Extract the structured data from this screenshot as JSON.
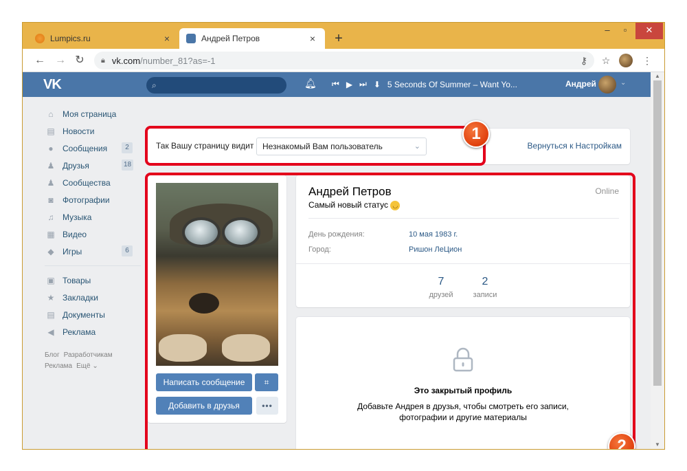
{
  "browser": {
    "tabs": [
      {
        "title": "Lumpics.ru",
        "close": "×"
      },
      {
        "title": "Андрей Петров",
        "close": "×"
      }
    ],
    "new_tab": "+",
    "controls": {
      "minimize": "–",
      "maximize": "▫",
      "close": "✕"
    },
    "url": {
      "host": "vk.com",
      "path": "/number_81?as=-1"
    },
    "menu": "⋮"
  },
  "vk": {
    "logo": "VK",
    "player": {
      "track": "5 Seconds Of Summer – Want Yo..."
    },
    "user_name": "Андрей"
  },
  "sidebar": {
    "items": [
      {
        "label": "Моя страница",
        "icon": "⌂"
      },
      {
        "label": "Новости",
        "icon": "▤"
      },
      {
        "label": "Сообщения",
        "icon": "●",
        "count": "2"
      },
      {
        "label": "Друзья",
        "icon": "♟",
        "count": "18"
      },
      {
        "label": "Сообщества",
        "icon": "♟"
      },
      {
        "label": "Фотографии",
        "icon": "◙"
      },
      {
        "label": "Музыка",
        "icon": "♫"
      },
      {
        "label": "Видео",
        "icon": "▦"
      },
      {
        "label": "Игры",
        "icon": "◆",
        "count": "6"
      }
    ],
    "items2": [
      {
        "label": "Товары",
        "icon": "▣"
      },
      {
        "label": "Закладки",
        "icon": "★"
      },
      {
        "label": "Документы",
        "icon": "▤"
      },
      {
        "label": "Реклама",
        "icon": "◀"
      }
    ],
    "footer": [
      "Блог",
      "Разработчикам",
      "Реклама",
      "Ещё ⌄"
    ]
  },
  "view_as": {
    "label": "Так Вашу страницу видит",
    "selected": "Незнакомый Вам пользователь",
    "back_link": "Вернуться к Настройкам"
  },
  "profile": {
    "name": "Андрей Петров",
    "status": "Самый новый статус",
    "online": "Online",
    "details": [
      {
        "label": "День рождения:",
        "value": "10 мая 1983 г."
      },
      {
        "label": "Город:",
        "value": "Ришон ЛеЦион"
      }
    ],
    "counters": [
      {
        "value": "7",
        "label": "друзей"
      },
      {
        "value": "2",
        "label": "записи"
      }
    ],
    "buttons": {
      "message": "Написать сообщение",
      "add_friend": "Добавить в друзья",
      "more": "•••"
    }
  },
  "closed": {
    "title": "Это закрытый профиль",
    "text": "Добавьте Андрея в друзья, чтобы смотреть его записи, фотографии и другие материалы"
  },
  "annotations": [
    "1",
    "2"
  ],
  "colors": {
    "vk_blue": "#4a76a8",
    "highlight": "#e3001b",
    "badge": "#e0400d",
    "browser_frame": "#e9b44a"
  }
}
